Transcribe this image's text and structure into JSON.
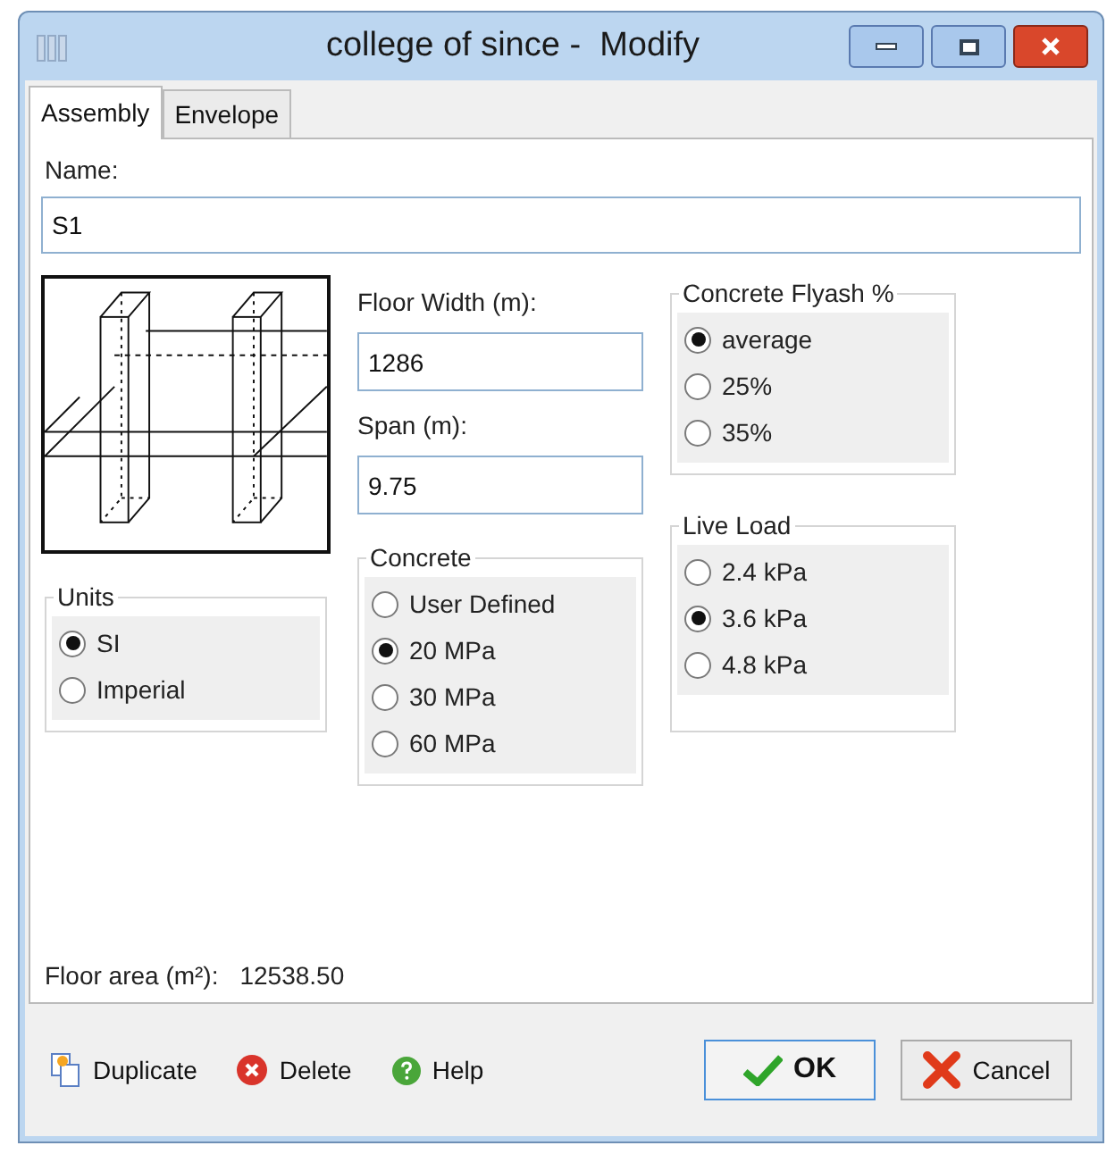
{
  "window": {
    "title": "college of since -  Modify"
  },
  "tabs": [
    {
      "label": "Assembly",
      "selected": true
    },
    {
      "label": "Envelope",
      "selected": false
    }
  ],
  "name_field": {
    "label": "Name:",
    "value": "S1"
  },
  "floor_width": {
    "label": "Floor Width (m):",
    "value": "1286"
  },
  "span": {
    "label": "Span (m):",
    "value": "9.75"
  },
  "groups": [
    {
      "title": "Units",
      "options": [
        {
          "label": "SI",
          "selected": true
        },
        {
          "label": "Imperial",
          "selected": false
        }
      ]
    },
    {
      "title": "Concrete",
      "options": [
        {
          "label": "User Defined",
          "selected": false
        },
        {
          "label": "20 MPa",
          "selected": true
        },
        {
          "label": "30 MPa",
          "selected": false
        },
        {
          "label": "60 MPa",
          "selected": false
        }
      ]
    },
    {
      "title": "Concrete Flyash %",
      "options": [
        {
          "label": "average",
          "selected": true
        },
        {
          "label": "25%",
          "selected": false
        },
        {
          "label": "35%",
          "selected": false
        }
      ]
    },
    {
      "title": "Live Load",
      "options": [
        {
          "label": "2.4 kPa",
          "selected": false
        },
        {
          "label": "3.6 kPa",
          "selected": true
        },
        {
          "label": "4.8 kPa",
          "selected": false
        }
      ]
    }
  ],
  "floor_area": {
    "label": "Floor area (m²):",
    "value": "12538.50"
  },
  "buttons": [
    {
      "label": "Duplicate",
      "kind": "duplicate"
    },
    {
      "label": "Delete",
      "kind": "delete"
    },
    {
      "label": "Help",
      "kind": "help"
    },
    {
      "label": "OK",
      "kind": "ok"
    },
    {
      "label": "Cancel",
      "kind": "cancel"
    }
  ]
}
